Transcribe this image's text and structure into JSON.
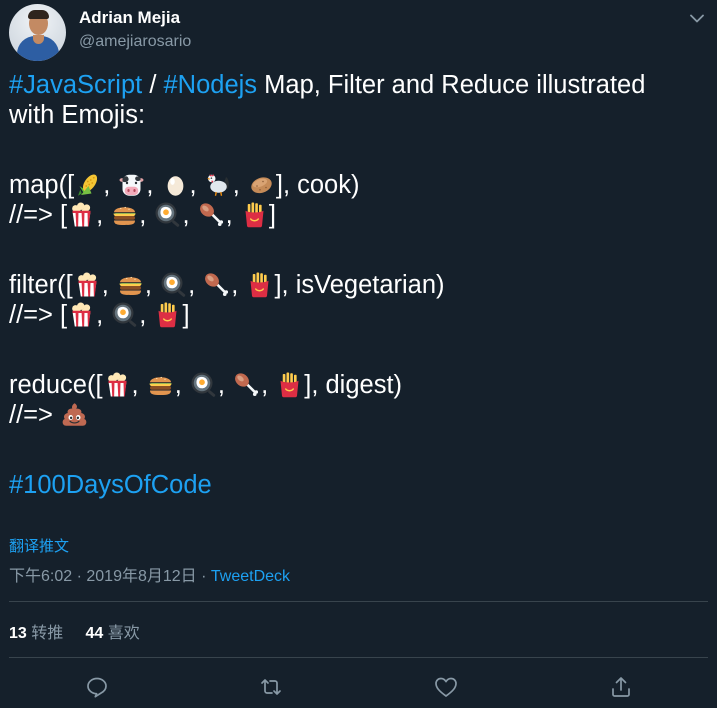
{
  "author": {
    "display_name": "Adrian Mejia",
    "handle": "@amejiarosario"
  },
  "tweet": {
    "line1_hashtag_js": "#JavaScript",
    "line1_sep": " / ",
    "line1_hashtag_node": "#Nodejs",
    "line1_rest": " Map, Filter and Reduce illustrated",
    "line2": "with Emojis:",
    "map": {
      "call_open": "map([",
      "inputs": [
        "corn-emoji",
        "cow-emoji",
        "egg-emoji",
        "chicken-emoji",
        "potato-emoji"
      ],
      "call_close": "], cook)",
      "result_prefix": "//=> [",
      "outputs": [
        "popcorn-emoji",
        "hamburger-emoji",
        "fried-egg-emoji",
        "poultry-leg-emoji",
        "fries-emoji"
      ],
      "result_close": "]"
    },
    "filter": {
      "call_open": "filter([",
      "inputs": [
        "popcorn-emoji",
        "hamburger-emoji",
        "fried-egg-emoji",
        "poultry-leg-emoji",
        "fries-emoji"
      ],
      "call_close": "], isVegetarian)",
      "result_prefix": "//=>  [",
      "outputs": [
        "popcorn-emoji",
        "fried-egg-emoji",
        "fries-emoji"
      ],
      "result_close": "]"
    },
    "reduce": {
      "call_open": "reduce([",
      "inputs": [
        "popcorn-emoji",
        "hamburger-emoji",
        "fried-egg-emoji",
        "poultry-leg-emoji",
        "fries-emoji"
      ],
      "call_close": "], digest)",
      "result_prefix": "//=> ",
      "outputs": [
        "poop-emoji"
      ]
    },
    "hashtag_footer": "#100DaysOfCode",
    "separator": ", "
  },
  "translate_label": "翻译推文",
  "meta": {
    "time": "下午6:02",
    "dot": " · ",
    "date": "2019年8月12日",
    "source": "TweetDeck"
  },
  "stats": {
    "retweets_count": "13",
    "retweets_label": "转推",
    "likes_count": "44",
    "likes_label": "喜欢"
  },
  "actions": [
    "reply-icon",
    "retweet-icon",
    "like-icon",
    "share-icon"
  ],
  "colors": {
    "background": "#15202b",
    "text": "#ffffff",
    "secondary": "#8899a6",
    "link": "#1da1f2",
    "divider": "#38444d"
  }
}
